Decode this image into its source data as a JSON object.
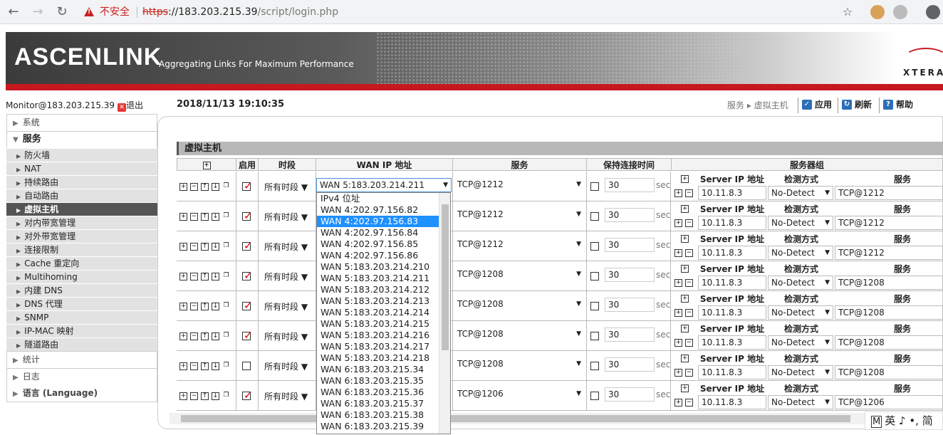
{
  "browser": {
    "insecure": "不安全",
    "url_scheme": "https",
    "url_host": "://183.203.215.39",
    "url_path": "/script/login.php"
  },
  "header": {
    "logo": "ASCENLINK",
    "tagline": "Aggregating Links For Maximum Performance",
    "brand": "XTERA"
  },
  "topbar": {
    "user": "Monitor@183.203.215.39",
    "logout": "退出",
    "datetime": "2018/11/13 19:10:35",
    "crumb1": "服务",
    "crumb2": "虚拟主机",
    "apply": "应用",
    "refresh": "刷新",
    "help": "帮助"
  },
  "sidebar": {
    "system": "系统",
    "services": "服务",
    "items": [
      "防火墙",
      "NAT",
      "持续路由",
      "自动路由",
      "虚拟主机",
      "对内带宽管理",
      "对外带宽管理",
      "连接限制",
      "Cache 重定向",
      "Multihoming",
      "内建 DNS",
      "DNS 代理",
      "SNMP",
      "IP-MAC 映射",
      "隧道路由"
    ],
    "stats": "统计",
    "log": "日志",
    "language": "语言 (Language)"
  },
  "panel": {
    "title": "虚拟主机"
  },
  "table": {
    "headers": {
      "plus": "+",
      "enable": "启用",
      "period": "时段",
      "wan": "WAN IP 地址",
      "service": "服务",
      "keepalive": "保持连接时间",
      "servergroup": "服务器组"
    },
    "sg_headers": {
      "plus": "+",
      "server_ip": "Server IP 地址",
      "detect": "检测方式",
      "service": "服务"
    },
    "rows": [
      {
        "enabled": true,
        "period": "所有时段",
        "wan": "WAN 5:183.203.214.211",
        "service": "TCP@1212",
        "keep": "30",
        "unit": "sec",
        "sip": "10.11.8.3",
        "detect": "No-Detect",
        "ssvc": "TCP@1212"
      },
      {
        "enabled": true,
        "period": "所有时段",
        "wan": "",
        "service": "TCP@1212",
        "keep": "30",
        "unit": "sec",
        "sip": "10.11.8.3",
        "detect": "No-Detect",
        "ssvc": "TCP@1212"
      },
      {
        "enabled": true,
        "period": "所有时段",
        "wan": "",
        "service": "TCP@1212",
        "keep": "30",
        "unit": "sec",
        "sip": "10.11.8.3",
        "detect": "No-Detect",
        "ssvc": "TCP@1212"
      },
      {
        "enabled": true,
        "period": "所有时段",
        "wan": "",
        "service": "TCP@1208",
        "keep": "30",
        "unit": "sec",
        "sip": "10.11.8.3",
        "detect": "No-Detect",
        "ssvc": "TCP@1208"
      },
      {
        "enabled": true,
        "period": "所有时段",
        "wan": "",
        "service": "TCP@1208",
        "keep": "30",
        "unit": "sec",
        "sip": "10.11.8.3",
        "detect": "No-Detect",
        "ssvc": "TCP@1208"
      },
      {
        "enabled": true,
        "period": "所有时段",
        "wan": "",
        "service": "TCP@1208",
        "keep": "30",
        "unit": "sec",
        "sip": "10.11.8.3",
        "detect": "No-Detect",
        "ssvc": "TCP@1208"
      },
      {
        "enabled": false,
        "period": "所有时段",
        "wan": "",
        "service": "TCP@1208",
        "keep": "30",
        "unit": "sec",
        "sip": "10.11.8.3",
        "detect": "No-Detect",
        "ssvc": "TCP@1208"
      },
      {
        "enabled": true,
        "period": "所有时段",
        "wan": "",
        "service": "TCP@1206",
        "keep": "30",
        "unit": "sec",
        "sip": "10.11.8.3",
        "detect": "No-Detect",
        "ssvc": "TCP@1206"
      }
    ]
  },
  "dropdown": {
    "selected_index": 2,
    "options": [
      "IPv4 位址",
      "WAN 4:202.97.156.82",
      "WAN 4:202.97.156.83",
      "WAN 4:202.97.156.84",
      "WAN 4:202.97.156.85",
      "WAN 4:202.97.156.86",
      "WAN 5:183.203.214.210",
      "WAN 5:183.203.214.211",
      "WAN 5:183.203.214.212",
      "WAN 5:183.203.214.213",
      "WAN 5:183.203.214.214",
      "WAN 5:183.203.214.215",
      "WAN 5:183.203.214.216",
      "WAN 5:183.203.214.217",
      "WAN 5:183.203.214.218",
      "WAN 6:183.203.215.34",
      "WAN 6:183.203.215.35",
      "WAN 6:183.203.215.36",
      "WAN 6:183.203.215.37",
      "WAN 6:183.203.215.38",
      "WAN 6:183.203.215.39"
    ]
  },
  "ime": {
    "text": "英 ♪ •, 简"
  }
}
